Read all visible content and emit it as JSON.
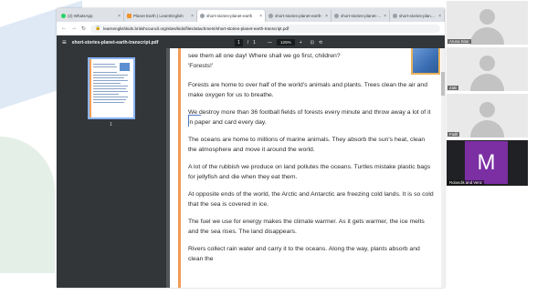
{
  "browser": {
    "tabs": [
      {
        "label": "(2) WhatsApp",
        "color": "#25d366",
        "active": false
      },
      {
        "label": "Planet Earth | LearnEnglish",
        "color": "#f0932b",
        "active": false
      },
      {
        "label": "short-stories-planet-earth",
        "color": "#5f6368",
        "active": true
      },
      {
        "label": "short-stories-planet-earth-",
        "color": "#5f6368",
        "active": false
      },
      {
        "label": "short-stories-planet-earth-",
        "color": "#5f6368",
        "active": false
      },
      {
        "label": "short-stories-planet-earth-",
        "color": "#5f6368",
        "active": false
      }
    ],
    "url": "learnenglishkids.britishcouncil.org/sites/kids/files/attachment/short-stories-planet-earth-transcript.pdf"
  },
  "pdf": {
    "filename": "short-stories-planet-earth-transcript.pdf",
    "page_current": "1",
    "page_sep": "/",
    "page_total": "1",
    "zoom": "125%",
    "thumb_page": "1",
    "lines": [
      "see them all one day! Where shall we go first, children?",
      "'Forests!'"
    ],
    "paragraphs": [
      "Forests are home to over half of the world's animals and plants. Trees clean the air and make oxygen for us to breathe.",
      "We destroy more than 36 football fields of forests every minute and throw away a lot of it in paper and card every day.",
      "The oceans are home to millions of marine animals. They absorb the sun's heat, clean the atmosphere and move it around the world.",
      "A lot of the rubbish we produce on land pollutes the oceans. Turtles mistake plastic bags for jellyfish and die when they eat them.",
      "At opposite ends of the world, the Arctic and Antarctic are freezing cold lands. It is so cold that the sea is covered in ice.",
      "The fuel we use for energy makes the climate warmer. As it gets warmer, the ice melts and the sea rises. The land disappears.",
      "Rivers collect rain water and carry it to the oceans. Along the way, plants absorb and clean the"
    ]
  },
  "participants": [
    {
      "name": "Aruna Sitar"
    },
    {
      "name": "Zaki"
    },
    {
      "name": "Fadil"
    },
    {
      "name": "Rolandik and Venz",
      "initial": "M",
      "color": "#7b2fa3"
    }
  ]
}
